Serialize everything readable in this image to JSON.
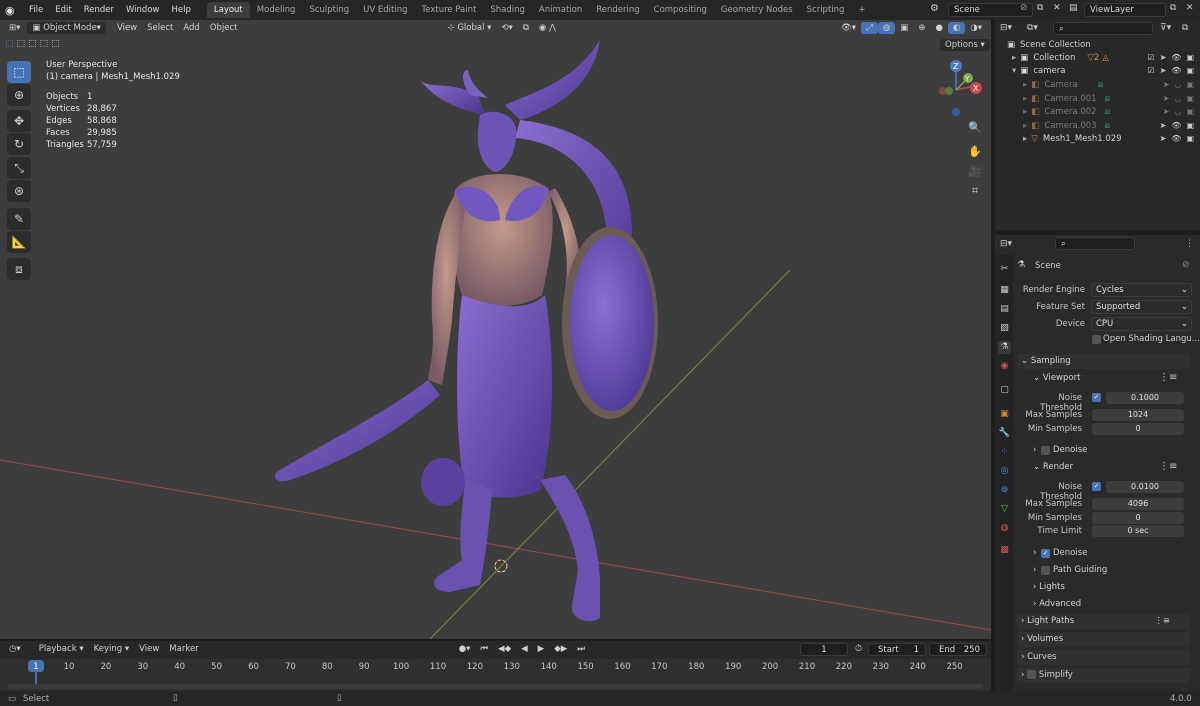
{
  "menu": [
    "File",
    "Edit",
    "Render",
    "Window",
    "Help"
  ],
  "workspaces": [
    {
      "label": "Layout",
      "active": true
    },
    {
      "label": "Modeling"
    },
    {
      "label": "Sculpting"
    },
    {
      "label": "UV Editing"
    },
    {
      "label": "Texture Paint"
    },
    {
      "label": "Shading"
    },
    {
      "label": "Animation"
    },
    {
      "label": "Rendering"
    },
    {
      "label": "Compositing"
    },
    {
      "label": "Geometry Nodes"
    },
    {
      "label": "Scripting"
    }
  ],
  "add_workspace": "+",
  "scene_field": "Scene",
  "viewlayer_field": "ViewLayer",
  "viewport": {
    "mode": "Object Mode",
    "menus": [
      "View",
      "Select",
      "Add",
      "Object"
    ],
    "orientation": "Global",
    "options_label": "Options",
    "perspective": "User Perspective",
    "active_object": "(1) camera | Mesh1_Mesh1.029",
    "stats": [
      {
        "label": "Objects",
        "value": "1"
      },
      {
        "label": "Vertices",
        "value": "28,867"
      },
      {
        "label": "Edges",
        "value": "58,868"
      },
      {
        "label": "Faces",
        "value": "29,985"
      },
      {
        "label": "Triangles",
        "value": "57,759"
      }
    ],
    "gizmo": {
      "z": "Z",
      "y": "Y",
      "x": "X"
    }
  },
  "outliner": {
    "title": "Scene Collection",
    "rows": [
      {
        "label": "Collection"
      },
      {
        "label": "camera"
      },
      {
        "label": "Camera"
      },
      {
        "label": "Camera.001"
      },
      {
        "label": "Camera.002"
      },
      {
        "label": "Camera.003"
      },
      {
        "label": "Mesh1_Mesh1.029"
      }
    ]
  },
  "properties": {
    "context": "Scene",
    "render_engine_label": "Render Engine",
    "render_engine": "Cycles",
    "feature_set_label": "Feature Set",
    "feature_set": "Supported",
    "device_label": "Device",
    "device": "CPU",
    "osl_label": "Open Shading Langu...",
    "sampling": "Sampling",
    "viewport_sub": "Viewport",
    "noise_threshold_label": "Noise Threshold",
    "vp_noise_threshold": "0.1000",
    "max_samples_label": "Max Samples",
    "vp_max_samples": "1024",
    "min_samples_label": "Min Samples",
    "vp_min_samples": "0",
    "denoise_label": "Denoise",
    "render_sub": "Render",
    "r_noise_threshold": "0.0100",
    "r_max_samples": "4096",
    "r_min_samples": "0",
    "time_limit_label": "Time Limit",
    "r_time_limit": "0 sec",
    "path_guiding": "Path Guiding",
    "lights": "Lights",
    "advanced": "Advanced",
    "light_paths": "Light Paths",
    "volumes": "Volumes",
    "curves": "Curves",
    "simplify": "Simplify"
  },
  "timeline": {
    "menus": [
      "Playback",
      "Keying",
      "View",
      "Marker"
    ],
    "current_frame": "1",
    "start_label": "Start",
    "start": "1",
    "end_label": "End",
    "end": "250",
    "ticks": [
      "1",
      "10",
      "20",
      "30",
      "40",
      "50",
      "60",
      "70",
      "80",
      "90",
      "100",
      "110",
      "120",
      "130",
      "140",
      "150",
      "160",
      "170",
      "180",
      "190",
      "200",
      "210",
      "220",
      "230",
      "240",
      "250"
    ]
  },
  "status": {
    "left": "Select",
    "version": "4.0.0"
  },
  "colors": {
    "accent": "#4772b3",
    "viewport_bg": "#3d3d3d",
    "x_axis": "#c8484f",
    "y_axis": "#7fa94a",
    "z_axis": "#4a79c8",
    "mesh_purple": "#6b4fb8"
  }
}
